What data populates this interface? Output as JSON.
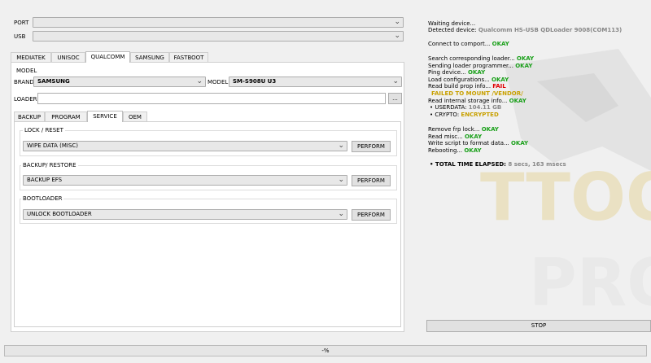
{
  "connection": {
    "port_label": "PORT",
    "usb_label": "USB",
    "port_value": "",
    "usb_value": ""
  },
  "platform_tabs": [
    "MEDIATEK",
    "UNISOC",
    "QUALCOMM",
    "SAMSUNG",
    "FASTBOOT"
  ],
  "model": {
    "group_label": "MODEL",
    "brand_label": "BRAND",
    "brand_value": "SAMSUNG",
    "model_label": "MODEL",
    "model_value": "SM-S908U U3",
    "loader_label": "LOADER",
    "loader_value": "",
    "browse_label": "..."
  },
  "sub_tabs": [
    "BACKUP",
    "PROGRAM",
    "SERVICE",
    "OEM"
  ],
  "sections": {
    "lock_reset": {
      "title": "LOCK / RESET",
      "option": "WIPE DATA (MISC)",
      "button": "PERFORM"
    },
    "backup_restore": {
      "title": "BACKUP/ RESTORE",
      "option": "BACKUP EFS",
      "button": "PERFORM"
    },
    "bootloader": {
      "title": "BOOTLOADER",
      "option": "UNLOCK BOOTLOADER",
      "button": "PERFORM"
    }
  },
  "log": {
    "waiting": "Waiting device...",
    "detected_label": "Detected device: ",
    "detected_value": "Qualcomm HS-USB QDLoader 9008(COM113)",
    "connect": "Connect to comport... ",
    "search_loader": "Search corresponding loader... ",
    "sending": "Sending loader programmer... ",
    "ping": "Ping device... ",
    "load_config": "Load configurations... ",
    "read_build": "Read build prop info... ",
    "mount_fail": "FAILED TO MOUNT /VENDOR/",
    "read_storage": "Read internal storage info... ",
    "userdata_label": "USERDATA: ",
    "userdata_value": "104.11 GB",
    "crypto_label": "CRYPTO: ",
    "crypto_value": "ENCRYPTED",
    "remove_frp": "Remove frp lock... ",
    "read_misc": "Read misc... ",
    "write_script": "Write script to format data... ",
    "rebooting": "Rebooting... ",
    "okay": "OKAY",
    "fail": "FAIL",
    "total_label": "TOTAL TIME ELAPSED: ",
    "total_value": "8 secs, 163 msecs"
  },
  "stop_label": "STOP",
  "progress_label": "-%",
  "watermark": {
    "line1": "TTOO",
    "line2": "PRO"
  },
  "colors": {
    "okay": "#1aa01a",
    "fail": "#e00000",
    "warn": "#c8a000"
  }
}
